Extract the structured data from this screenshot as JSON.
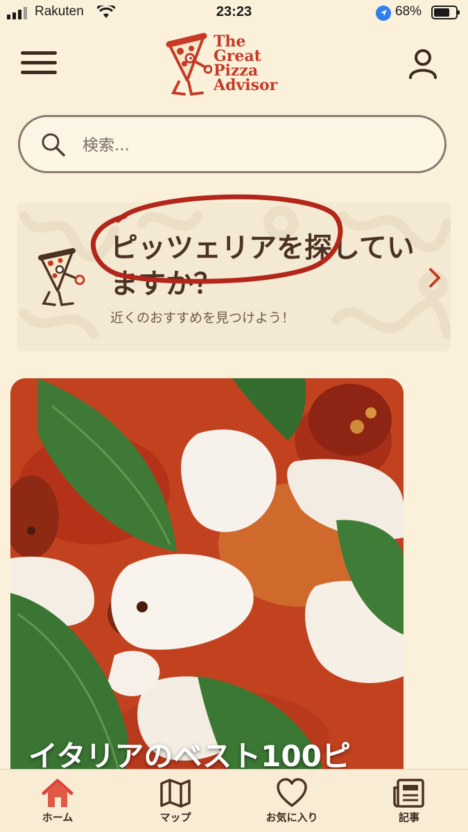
{
  "status_bar": {
    "carrier": "Rakuten",
    "time": "23:23",
    "battery": "68%"
  },
  "header": {
    "logo_lines": [
      "The",
      "Great",
      "Pizza",
      "Advisor"
    ],
    "menu_icon": "hamburger-menu-icon",
    "account_icon": "user-icon"
  },
  "search": {
    "placeholder": "検索..."
  },
  "promo": {
    "title": "ピッツェリアを探していますか？",
    "subtitle": "近くのおすすめを見つけよう！"
  },
  "feature": {
    "title": "イタリアのベスト100ピ"
  },
  "bottom_nav": {
    "items": [
      {
        "label": "ホーム",
        "icon": "home-icon",
        "active": true
      },
      {
        "label": "マップ",
        "icon": "map-icon",
        "active": false
      },
      {
        "label": "お気に入り",
        "icon": "heart-icon",
        "active": false
      },
      {
        "label": "記事",
        "icon": "newspaper-icon",
        "active": false
      }
    ]
  },
  "colors": {
    "background": "#fbf1da",
    "brand_red": "#c63a26",
    "text_brown": "#4b3225",
    "annotation_red": "#b3261a"
  }
}
